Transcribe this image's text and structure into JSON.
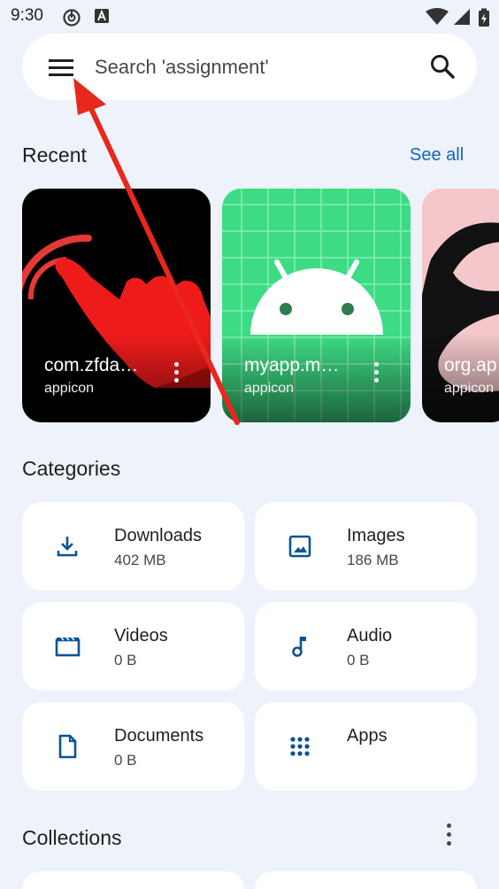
{
  "status_bar": {
    "time": "9:30"
  },
  "search": {
    "placeholder": "Search 'assignment'"
  },
  "recent": {
    "title": "Recent",
    "see_all": "See all",
    "items": [
      {
        "name": "com.zfda…",
        "sub": "appicon"
      },
      {
        "name": "myapp.m…",
        "sub": "appicon"
      },
      {
        "name": "org.ap",
        "sub": "appicon"
      }
    ]
  },
  "categories": {
    "title": "Categories",
    "items": [
      {
        "label": "Downloads",
        "size": "402 MB",
        "icon": "download-icon"
      },
      {
        "label": "Images",
        "size": "186 MB",
        "icon": "image-icon"
      },
      {
        "label": "Videos",
        "size": "0 B",
        "icon": "video-icon"
      },
      {
        "label": "Audio",
        "size": "0 B",
        "icon": "music-note-icon"
      },
      {
        "label": "Documents",
        "size": "0 B",
        "icon": "document-icon"
      },
      {
        "label": "Apps",
        "size": "",
        "icon": "apps-grid-icon"
      }
    ]
  },
  "collections": {
    "title": "Collections"
  },
  "colors": {
    "accent": "#1565c0",
    "background": "#eef2fb",
    "icon": "#0b5394",
    "arrow": "#e8271d"
  }
}
